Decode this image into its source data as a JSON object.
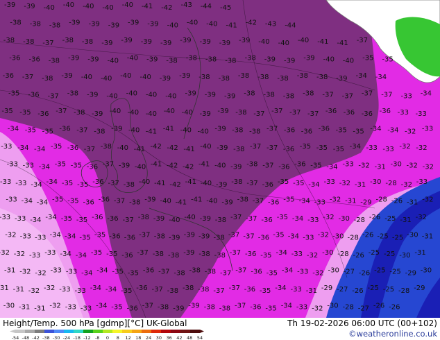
{
  "header": {
    "title_left": "Height/Temp. 500 hPa [gdmp][°C] UK-Global",
    "title_right": "Th 19-02-2026 06:00 UTC (00+102)",
    "site": "©weatheronline.co.uk"
  },
  "legend": {
    "ticks": [
      "-54",
      "-48",
      "-42",
      "-38",
      "-30",
      "-24",
      "-18",
      "-12",
      "-8",
      "0",
      "8",
      "12",
      "18",
      "24",
      "30",
      "36",
      "42",
      "48",
      "54"
    ],
    "colors": [
      "#c6c6c6",
      "#a8a8a8",
      "#7d7d7d",
      "#3c53d8",
      "#4f89f7",
      "#18b8f0",
      "#2fd7c6",
      "#12a21e",
      "#58d21b",
      "#b3e820",
      "#f5f528",
      "#f7cc1c",
      "#f4a414",
      "#ec6d0e",
      "#de2a0a",
      "#b2060b",
      "#8c0712",
      "#701415",
      "#4d0d0d"
    ]
  },
  "map": {
    "colors": {
      "sea": "#7f2f81",
      "deep": "#6e2474",
      "magenta": "#e22be5",
      "light": "#ee9ef0",
      "lighter": "#f4b8f5",
      "blue": "#2647d2",
      "darkblue": "#1a1fb5",
      "land": "#ffffff",
      "green": "#37c633"
    },
    "labels": [
      "39",
      "39",
      "40",
      "40",
      "40",
      "40",
      "40",
      "41",
      "42",
      "43",
      "44",
      "45",
      "38",
      "38",
      "38",
      "39",
      "39",
      "39",
      "39",
      "39",
      "40",
      "40",
      "40",
      "41",
      "42",
      "43",
      "44",
      "38",
      "38",
      "37",
      "38",
      "38",
      "39",
      "39",
      "39",
      "39",
      "39",
      "39",
      "39",
      "39",
      "40",
      "40",
      "40",
      "41",
      "41",
      "37",
      "36",
      "36",
      "38",
      "39",
      "39",
      "40",
      "40",
      "39",
      "38",
      "38",
      "38",
      "38",
      "38",
      "39",
      "39",
      "39",
      "40",
      "40",
      "35",
      "35",
      "36",
      "37",
      "38",
      "39",
      "40",
      "40",
      "40",
      "40",
      "39",
      "39",
      "38",
      "38",
      "38",
      "38",
      "38",
      "38",
      "38",
      "39",
      "34",
      "34",
      "35",
      "36",
      "37",
      "38",
      "39",
      "40",
      "40",
      "40",
      "40",
      "39",
      "39",
      "39",
      "38",
      "38",
      "38",
      "38",
      "37",
      "37",
      "37",
      "37",
      "33",
      "34",
      "35",
      "35",
      "36",
      "37",
      "38",
      "39",
      "40",
      "40",
      "40",
      "40",
      "40",
      "39",
      "39",
      "38",
      "37",
      "37",
      "37",
      "37",
      "36",
      "36",
      "36",
      "36",
      "33",
      "33",
      "34",
      "35",
      "35",
      "36",
      "37",
      "38",
      "39",
      "40",
      "41",
      "41",
      "40",
      "40",
      "39",
      "38",
      "38",
      "37",
      "36",
      "36",
      "36",
      "35",
      "35",
      "34",
      "34",
      "32",
      "33",
      "33",
      "34",
      "34",
      "35",
      "36",
      "37",
      "38",
      "40",
      "41",
      "42",
      "42",
      "41",
      "40",
      "39",
      "38",
      "37",
      "37",
      "36",
      "35",
      "35",
      "35",
      "34",
      "33",
      "33",
      "32",
      "32",
      "33",
      "33",
      "34",
      "35",
      "35",
      "36",
      "37",
      "39",
      "40",
      "41",
      "42",
      "42",
      "41",
      "40",
      "39",
      "38",
      "37",
      "36",
      "36",
      "35",
      "34",
      "33",
      "32",
      "31",
      "30",
      "32",
      "32",
      "33",
      "33",
      "34",
      "34",
      "35",
      "35",
      "36",
      "37",
      "38",
      "40",
      "41",
      "42",
      "41",
      "40",
      "39",
      "38",
      "37",
      "36",
      "35",
      "35",
      "34",
      "33",
      "32",
      "31",
      "30",
      "28",
      "32",
      "33",
      "33",
      "34",
      "34",
      "35",
      "35",
      "36",
      "36",
      "37",
      "38",
      "39",
      "40",
      "41",
      "41",
      "40",
      "39",
      "38",
      "37",
      "36",
      "35",
      "34",
      "33",
      "32",
      "31",
      "29",
      "28",
      "26",
      "31",
      "32",
      "33",
      "33",
      "34",
      "34",
      "35",
      "35",
      "36",
      "36",
      "37",
      "38",
      "39",
      "40",
      "40",
      "39",
      "38",
      "37",
      "37",
      "36",
      "35",
      "34",
      "33",
      "32",
      "30",
      "28",
      "26",
      "25",
      "31",
      "32",
      "32",
      "33",
      "33",
      "34",
      "34",
      "35",
      "35",
      "36",
      "36",
      "37",
      "38",
      "39",
      "39",
      "39",
      "38",
      "37",
      "37",
      "36",
      "35",
      "34",
      "33",
      "32",
      "30",
      "28",
      "26",
      "25",
      "25",
      "30",
      "31",
      "32",
      "32",
      "33",
      "33",
      "34",
      "34",
      "35",
      "35",
      "36",
      "37",
      "38",
      "38",
      "39",
      "38",
      "38",
      "37",
      "36",
      "35",
      "34",
      "33",
      "32",
      "30",
      "28",
      "26",
      "25",
      "25",
      "30",
      "31",
      "31",
      "32",
      "32",
      "33",
      "33",
      "34",
      "34",
      "35",
      "35",
      "36",
      "37",
      "38",
      "38",
      "38",
      "37",
      "37",
      "36",
      "35",
      "34",
      "33",
      "32",
      "30",
      "27",
      "26",
      "25",
      "25",
      "29",
      "30",
      "31",
      "31",
      "32",
      "32",
      "33",
      "33",
      "34",
      "34",
      "35",
      "36",
      "37",
      "38",
      "38",
      "38",
      "37",
      "37",
      "36",
      "35",
      "34",
      "33",
      "31",
      "29",
      "27",
      "26",
      "25",
      "25",
      "28",
      "29",
      "30",
      "31",
      "31",
      "32",
      "33",
      "33",
      "34",
      "35",
      "36",
      "37",
      "38",
      "39",
      "39",
      "38",
      "38",
      "37",
      "36",
      "35",
      "34",
      "33",
      "32",
      "30",
      "28",
      "27",
      "26",
      "26"
    ]
  }
}
